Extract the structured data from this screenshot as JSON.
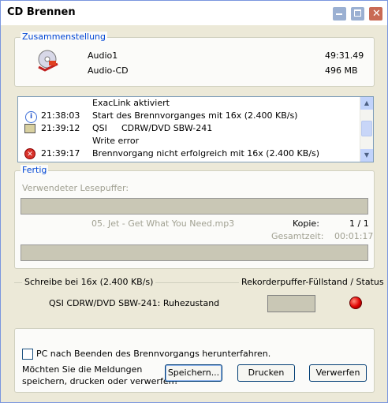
{
  "window": {
    "title": "CD Brennen"
  },
  "compilation": {
    "group_title": "Zusammenstellung",
    "name": "Audio1",
    "type": "Audio-CD",
    "duration": "49:31.49",
    "size": "496 MB"
  },
  "log": [
    {
      "icon": "",
      "time": "",
      "device": "",
      "text": "ExacLink aktiviert"
    },
    {
      "icon": "info-icon",
      "time": "21:38:03",
      "device": "",
      "text": "Start des Brennvorganges mit 16x (2.400 KB/s)"
    },
    {
      "icon": "drive-icon",
      "time": "21:39:12",
      "device": "QSI",
      "text": "CDRW/DVD SBW-241"
    },
    {
      "icon": "",
      "time": "",
      "device": "",
      "text": "Write error"
    },
    {
      "icon": "error-icon",
      "time": "21:39:17",
      "device": "",
      "text": "Brennvorgang nicht erfolgreich mit 16x (2.400 KB/s)"
    }
  ],
  "progress": {
    "group_title": "Fertig",
    "buffer_label": "Verwendeter Lesepuffer:",
    "current_file": "05. Jet - Get What You Need.mp3",
    "copy_label": "Kopie:",
    "copy_value": "1 / 1",
    "total_label": "Gesamtzeit:",
    "total_value": "00:01:17"
  },
  "writer": {
    "speed_label": "Schreibe bei 16x (2.400 KB/s)",
    "buffer_status_label": "Rekorderpuffer-Füllstand / Status",
    "drive_status": "QSI CDRW/DVD SBW-241: Ruhezustand"
  },
  "footer": {
    "shutdown_label": "PC nach Beenden des Brennvorgangs herunterfahren.",
    "question_line1": "Möchten Sie die Meldungen",
    "question_line2": "speichern, drucken oder verwerfen?",
    "save_label": "Speichern...",
    "print_label": "Drucken",
    "discard_label": "Verwerfen"
  }
}
